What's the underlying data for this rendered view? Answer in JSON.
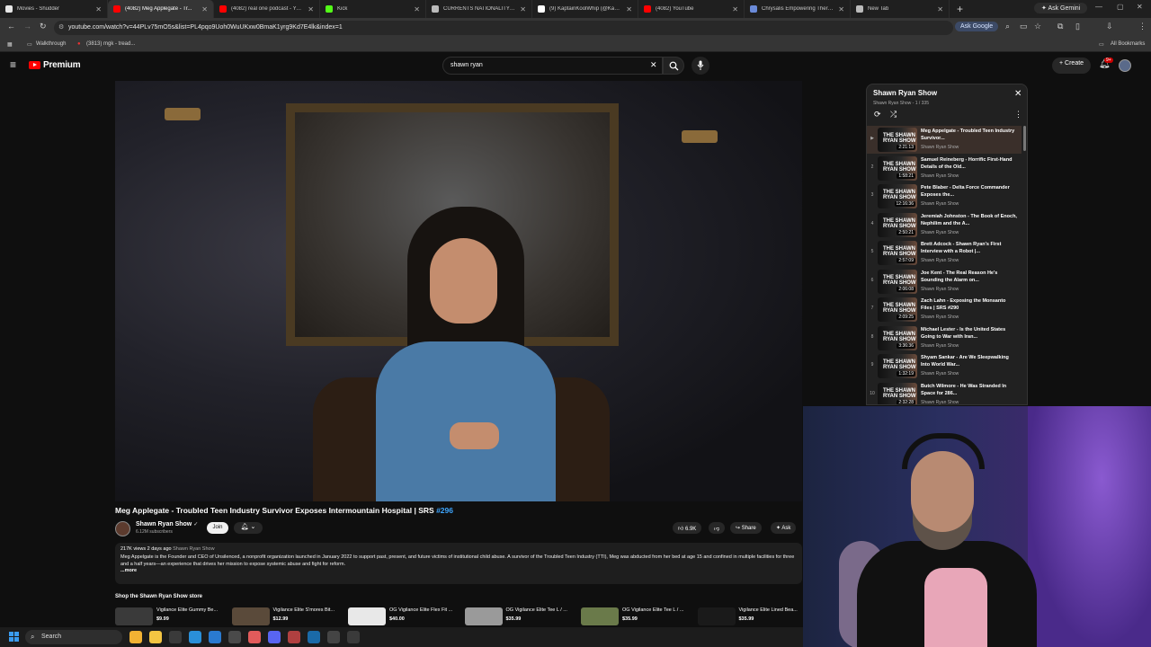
{
  "browser": {
    "tabs": [
      {
        "title": "Movies - Shudder",
        "color": "#e6e6e6",
        "active": false
      },
      {
        "title": "(4082) Meg Applegate - Tr...",
        "color": "#ff0000",
        "active": true
      },
      {
        "title": "(4082) real one podcast - YouT...",
        "color": "#ff0000",
        "active": false
      },
      {
        "title": "Kick",
        "color": "#53fc18",
        "active": false
      },
      {
        "title": "CURRENTS NATIONALITY - Go...",
        "color": "#bbbbbb",
        "active": false
      },
      {
        "title": "(9) KaptainKoolWhip (@Kaptai...",
        "color": "#ffffff",
        "active": false
      },
      {
        "title": "(4082) YouTube",
        "color": "#ff0000",
        "active": false
      },
      {
        "title": "Chrysalis Empowering Therap...",
        "color": "#6a8ad8",
        "active": false
      },
      {
        "title": "New Tab",
        "color": "#bbbbbb",
        "active": false
      }
    ],
    "ask_gemini": "Ask Gemini",
    "url": "youtube.com/watch?v=44PLv75mO5s&list=PL4pqo9Uoh0WuUKxw0BmaK1yrg9Kd7E4lk&index=1",
    "ask_google": "Ask Google",
    "bookmarks": [
      {
        "label": "Walkthrough"
      },
      {
        "label": "(3813) mgk - tread..."
      }
    ],
    "all_bookmarks": "All Bookmarks"
  },
  "youtube": {
    "logo_word": "Premium",
    "search_value": "shawn ryan",
    "create_label": "Create",
    "notification_count": "9+"
  },
  "video": {
    "title": "Meg Applegate - Troubled Teen Industry Survivor Exposes Intermountain Hospital | SRS ",
    "hashtag": "#296",
    "channel": "Shawn Ryan Show",
    "subscribers": "6.12M subscribers",
    "join": "Join",
    "likes": "6.9K",
    "share": "Share",
    "ask": "Ask",
    "views_date": "217K views  2 days ago ",
    "desc_channel": "Shawn Ryan Show",
    "description": "Meg Appelgate is the Founder and CEO of Unsilenced, a nonprofit organization launched in January 2022 to support past, present, and future victims of institutional child abuse. A survivor of the Troubled Teen Industry (TTI), Meg was abducted from her bed at age 15 and confined in multiple facilities for three and a half years—an experience that drives her mission to expose systemic abuse and fight for reform.",
    "more": "...more"
  },
  "store": {
    "heading": "Shop the Shawn Ryan Show store",
    "items": [
      {
        "name": "Vigilance Elite Gummy Be...",
        "price": "$9.99",
        "color": "#3a3a3a"
      },
      {
        "name": "Vigilance Elite S'mores Bit...",
        "price": "$12.99",
        "color": "#5a4a3a"
      },
      {
        "name": "OG Vigilance Elite Flex Fit ...",
        "price": "$40.00",
        "color": "#e8e8e8"
      },
      {
        "name": "OG Vigilance Elite Tee L / ...",
        "price": "$35.99",
        "color": "#9a9a9a"
      },
      {
        "name": "OG Vigilance Elite Tee L / ...",
        "price": "$35.99",
        "color": "#6a7a4a"
      },
      {
        "name": "Vigilance Elite Lined Bea...",
        "price": "$35.99",
        "color": "#1a1a1a"
      }
    ]
  },
  "playlist": {
    "title": "Shawn Ryan Show",
    "subtitle": "Shawn Ryan Show - 1 / 335",
    "thumb_brand": "THE SHAWN RYAN SHOW",
    "items": [
      {
        "index": "▶",
        "title": "Meg Appelgate - Troubled Teen Industry Survivor...",
        "channel": "Shawn Ryan Show",
        "duration": "2:21:13",
        "current": true
      },
      {
        "index": "2",
        "title": "Samuel Reineberg - Horrific First-Hand Details of the Old...",
        "channel": "Shawn Ryan Show",
        "duration": "1:58:21",
        "current": false
      },
      {
        "index": "3",
        "title": "Pete Blaber - Delta Force Commander Exposes the...",
        "channel": "Shawn Ryan Show",
        "duration": "12:16:36",
        "current": false
      },
      {
        "index": "4",
        "title": "Jeremiah Johnston - The Book of Enoch, Nephilim and the A...",
        "channel": "Shawn Ryan Show",
        "duration": "2:50:21",
        "current": false
      },
      {
        "index": "5",
        "title": "Brett Adcock - Shawn Ryan's First Interview with a Robot |...",
        "channel": "Shawn Ryan Show",
        "duration": "2:57:09",
        "current": false
      },
      {
        "index": "6",
        "title": "Joe Kent - The Real Reason He's Sounding the Alarm on...",
        "channel": "Shawn Ryan Show",
        "duration": "2:06:08",
        "current": false
      },
      {
        "index": "7",
        "title": "Zach Lahn - Exposing the Monsanto Files | SRS #290",
        "channel": "Shawn Ryan Show",
        "duration": "2:09:25",
        "current": false
      },
      {
        "index": "8",
        "title": "Michael Lester - Is the United States Going to War with Iran...",
        "channel": "Shawn Ryan Show",
        "duration": "3:36:36",
        "current": false
      },
      {
        "index": "9",
        "title": "Shyam Sankar - Are We Sleepwalking Into World War...",
        "channel": "Shawn Ryan Show",
        "duration": "1:32:19",
        "current": false
      },
      {
        "index": "10",
        "title": "Butch Wilmore - He Was Stranded In Space for 286...",
        "channel": "Shawn Ryan Show",
        "duration": "2:32:28",
        "current": false
      }
    ]
  },
  "taskbar": {
    "search_label": "Search",
    "apps": [
      {
        "name": "chrome-icon",
        "color": "#f2b233"
      },
      {
        "name": "file-explorer-icon",
        "color": "#f4c542"
      },
      {
        "name": "terminal-icon",
        "color": "#3a3a3a"
      },
      {
        "name": "edge-icon",
        "color": "#2a8fd8"
      },
      {
        "name": "vscode-icon",
        "color": "#2a7ad0"
      },
      {
        "name": "app-icon",
        "color": "#4a4a4a"
      },
      {
        "name": "colorful-app-icon",
        "color": "#e25b5b"
      },
      {
        "name": "discord-icon",
        "color": "#5865f2"
      },
      {
        "name": "capture-icon",
        "color": "#b04040"
      },
      {
        "name": "steam-icon",
        "color": "#1a6aa8"
      },
      {
        "name": "obs-icon",
        "color": "#444444"
      },
      {
        "name": "settings-icon",
        "color": "#3a3a3a"
      }
    ]
  }
}
